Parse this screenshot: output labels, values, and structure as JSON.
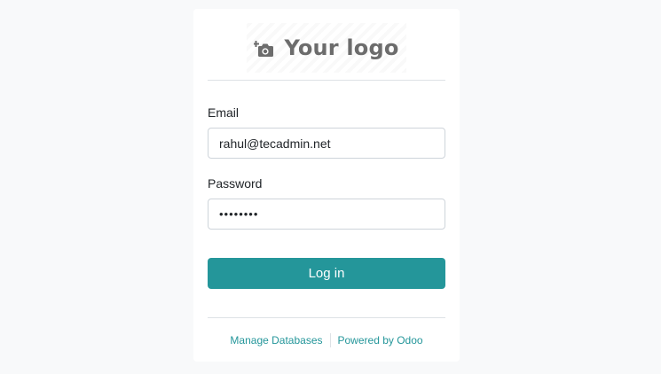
{
  "logo": {
    "text": "Your logo",
    "icon": "camera-plus-icon"
  },
  "form": {
    "email_label": "Email",
    "email_value": "rahul@tecadmin.net",
    "password_label": "Password",
    "password_value": "••••••••",
    "login_label": "Log in"
  },
  "footer": {
    "manage_databases": "Manage Databases",
    "powered_by": "Powered by Odoo"
  },
  "colors": {
    "accent": "#24969a",
    "background": "#f8f9fa",
    "card": "#ffffff"
  }
}
